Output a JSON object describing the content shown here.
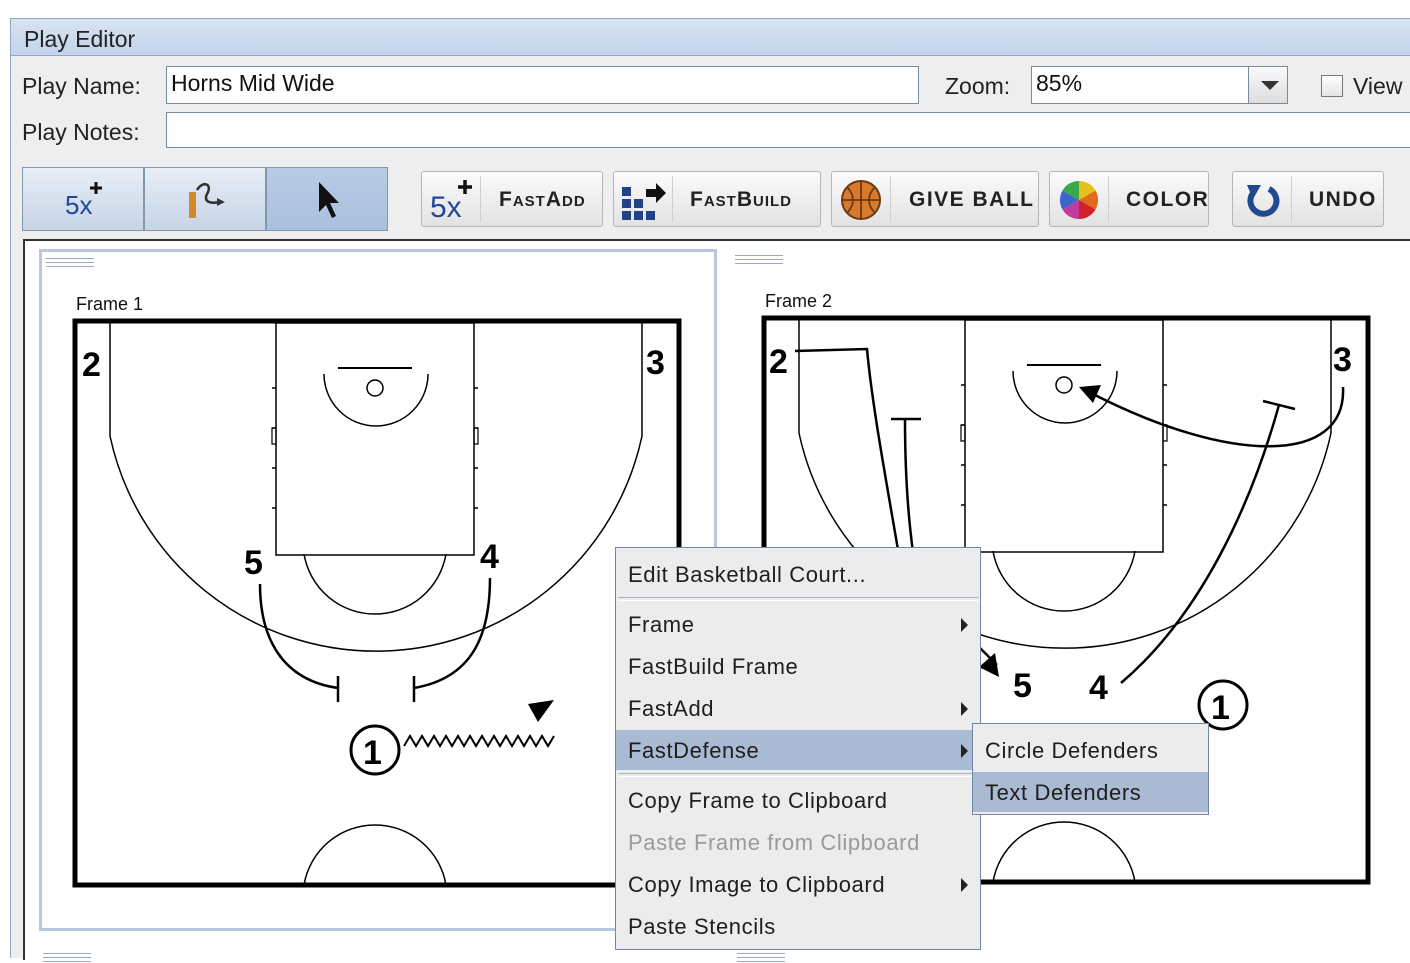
{
  "window": {
    "title": "Play Editor"
  },
  "form": {
    "play_name_label": "Play Name:",
    "play_name_value": "Horns Mid Wide",
    "zoom_label": "Zoom:",
    "zoom_value": "85%",
    "view_label": "View",
    "play_notes_label": "Play Notes:",
    "play_notes_value": ""
  },
  "mode_buttons": [
    {
      "name": "add-players",
      "icon": "5x-plus-icon",
      "label": "5x",
      "selected": false
    },
    {
      "name": "draw-path",
      "icon": "path-arrow-icon",
      "selected": false
    },
    {
      "name": "select",
      "icon": "pointer-icon",
      "selected": true
    }
  ],
  "toolbar": {
    "fastadd_icon_text": "5x",
    "fastadd_label": "FastAdd",
    "fastbuild_label": "FastBuild",
    "giveball_label": "GIVE BALL",
    "color_label": "COLOR",
    "undo_label": "UNDO"
  },
  "frames": [
    {
      "label": "Frame 1",
      "players": [
        {
          "num": "2"
        },
        {
          "num": "3"
        },
        {
          "num": "5"
        },
        {
          "num": "4"
        },
        {
          "num": "1",
          "circled": true
        }
      ]
    },
    {
      "label": "Frame 2",
      "players": [
        {
          "num": "2"
        },
        {
          "num": "3"
        },
        {
          "num": "5"
        },
        {
          "num": "4"
        },
        {
          "num": "1",
          "circled": true
        }
      ]
    }
  ],
  "context_menu": {
    "items": [
      {
        "label": "Edit Basketball Court...",
        "submenu": false,
        "enabled": true
      },
      {
        "label": "Frame",
        "submenu": true,
        "enabled": true
      },
      {
        "label": "FastBuild Frame",
        "submenu": false,
        "enabled": true
      },
      {
        "label": "FastAdd",
        "submenu": true,
        "enabled": true
      },
      {
        "label": "FastDefense",
        "submenu": true,
        "enabled": true,
        "highlighted": true
      },
      {
        "label": "Copy Frame to Clipboard",
        "submenu": false,
        "enabled": true
      },
      {
        "label": "Paste Frame from Clipboard",
        "submenu": false,
        "enabled": false
      },
      {
        "label": "Copy Image to Clipboard",
        "submenu": true,
        "enabled": true
      },
      {
        "label": "Paste Stencils",
        "submenu": false,
        "enabled": true
      }
    ],
    "submenu": [
      {
        "label": "Circle Defenders",
        "highlighted": false
      },
      {
        "label": "Text Defenders",
        "highlighted": true
      }
    ]
  },
  "colors": {
    "accent": "#a9bad2",
    "titlebar": "#c2d3ea",
    "ball": "#d9792b"
  }
}
